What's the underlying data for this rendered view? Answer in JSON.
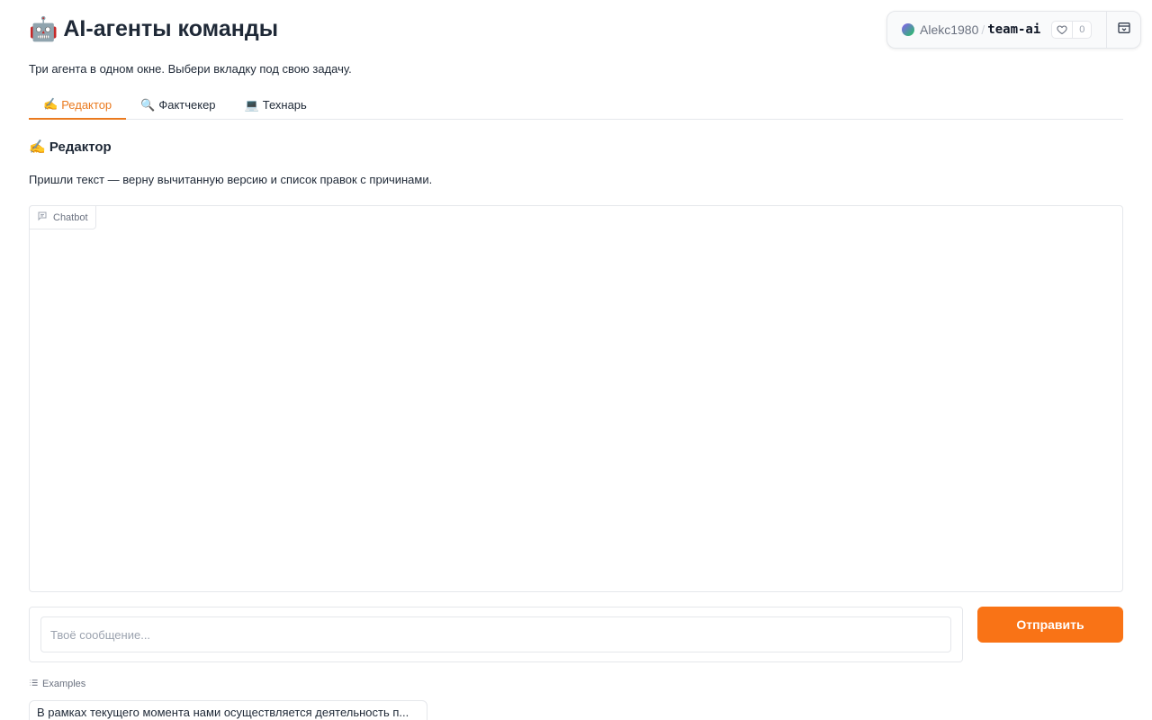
{
  "space": {
    "owner": "Alekc1980",
    "separator": "/",
    "name": "team-ai",
    "likes": "0"
  },
  "header": {
    "title_emoji": "🤖",
    "title": "AI-агенты команды",
    "subtitle": "Три агента в одном окне. Выбери вкладку под свою задачу."
  },
  "tabs": [
    {
      "emoji": "✍️",
      "label": "Редактор",
      "active": true
    },
    {
      "emoji": "🔍",
      "label": "Фактчекер",
      "active": false
    },
    {
      "emoji": "💻",
      "label": "Технарь",
      "active": false
    }
  ],
  "section": {
    "emoji": "✍️",
    "title": "Редактор",
    "description": "Пришли текст — верну вычитанную версию и список правок с причинами."
  },
  "chatbot": {
    "label": "Chatbot"
  },
  "input": {
    "value": "",
    "placeholder": "Твоё сообщение..."
  },
  "send_button": {
    "label": "Отправить"
  },
  "examples": {
    "label": "Examples",
    "items": [
      "В рамках текущего момента нами осуществляется деятельность п..."
    ]
  },
  "colors": {
    "accent": "#f97316",
    "active_tab": "#ea7a1f",
    "border": "#e5e7eb"
  }
}
